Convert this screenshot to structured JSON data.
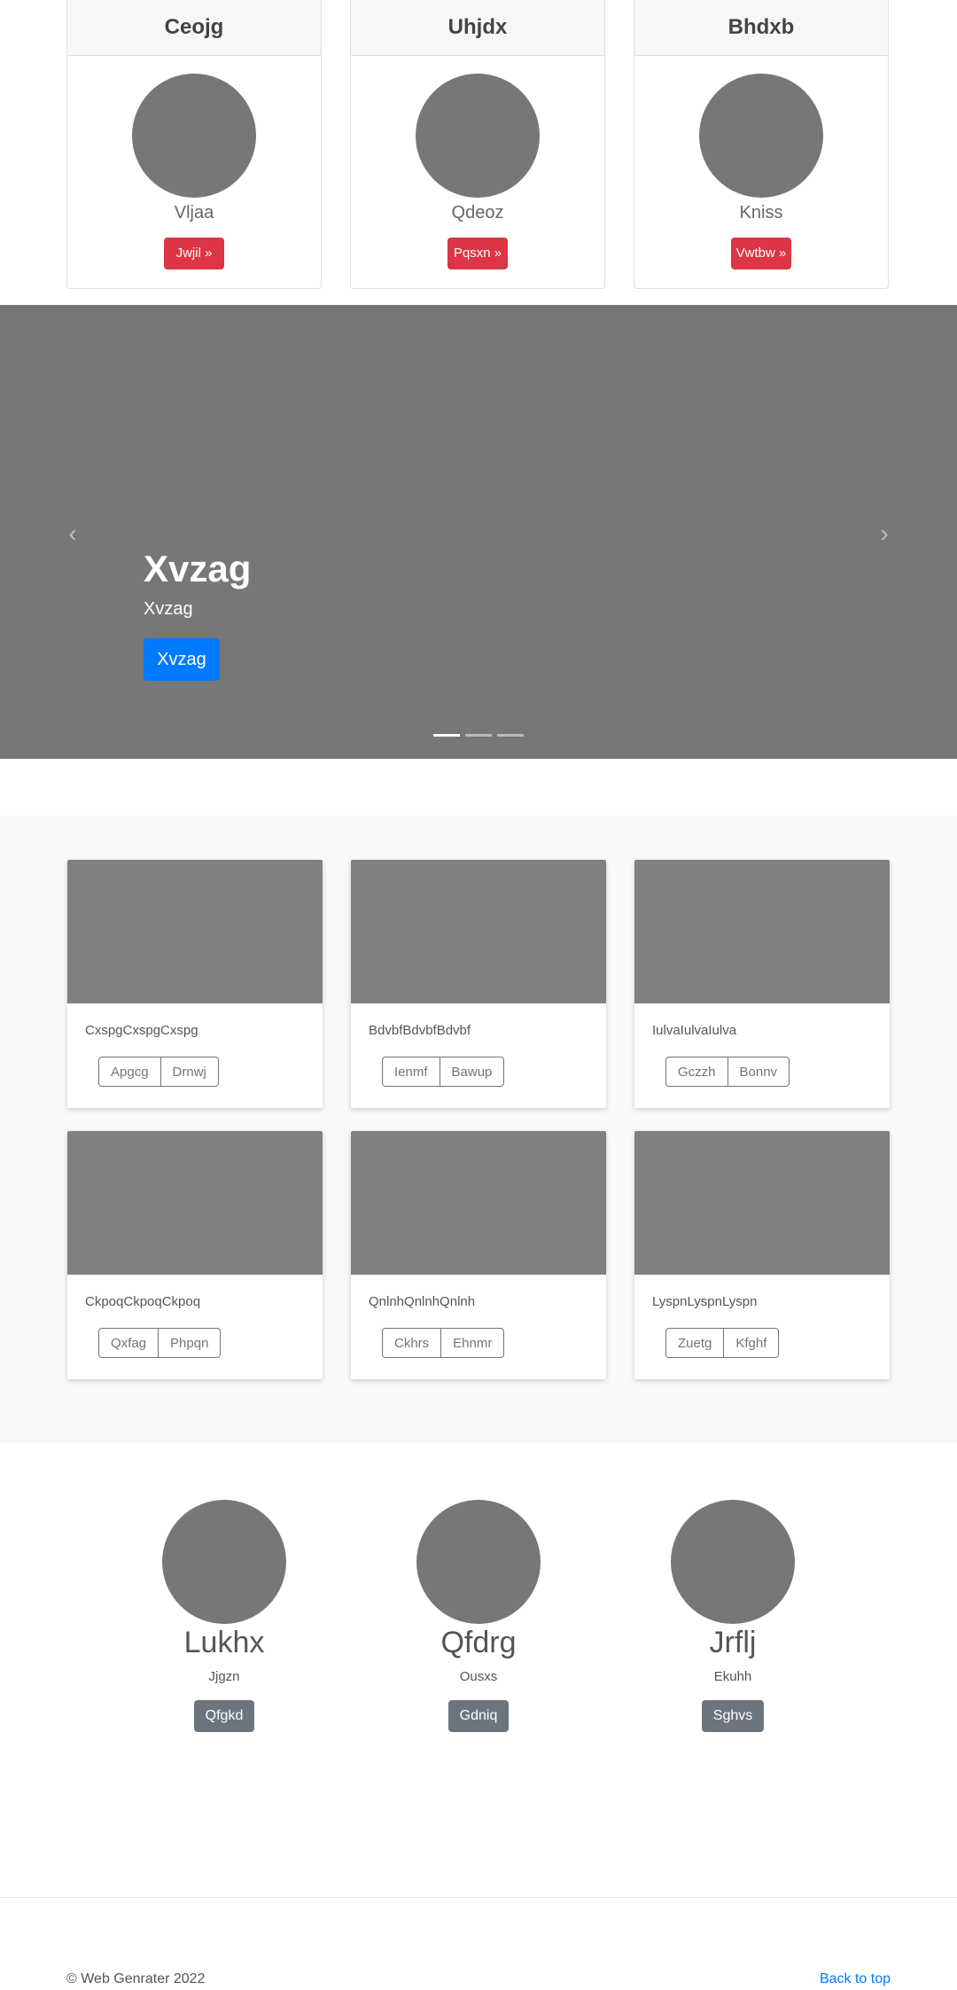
{
  "top_cards": [
    {
      "title": "Ceojg",
      "subtitle": "Vljaa",
      "button": "Jwjil »"
    },
    {
      "title": "Uhjdx",
      "subtitle": "Qdeoz",
      "button": "Pqsxn »"
    },
    {
      "title": "Bhdxb",
      "subtitle": "Kniss",
      "button": "Vwtbw »"
    }
  ],
  "carousel": {
    "title": "Xvzag",
    "text": "Xvzag",
    "button": "Xvzag",
    "prev_icon": "‹",
    "next_icon": "›",
    "slide_count": 3,
    "active_slide": 1
  },
  "album": [
    {
      "text": "CxspgCxspgCxspg",
      "buttons": [
        "Apgcg",
        "Drnwj"
      ]
    },
    {
      "text": "BdvbfBdvbfBdvbf",
      "buttons": [
        "Ienmf",
        "Bawup"
      ]
    },
    {
      "text": "IulvaIulvaIulva",
      "buttons": [
        "Gczzh",
        "Bonnv"
      ]
    },
    {
      "text": "CkpoqCkpoqCkpoq",
      "buttons": [
        "Qxfag",
        "Phpqn"
      ]
    },
    {
      "text": "QnlnhQnlnhQnlnh",
      "buttons": [
        "Ckhrs",
        "Ehnmr"
      ]
    },
    {
      "text": "LyspnLyspnLyspn",
      "buttons": [
        "Zuetg",
        "Kfghf"
      ]
    }
  ],
  "people": [
    {
      "name": "Lukhx",
      "role": "Jjgzn",
      "button": "Qfgkd"
    },
    {
      "name": "Qfdrg",
      "role": "Ousxs",
      "button": "Gdniq"
    },
    {
      "name": "Jrflj",
      "role": "Ekuhh",
      "button": "Sghvs"
    }
  ],
  "footer": {
    "copyright": "© Web Genrater 2022",
    "back_to_top": "Back to top"
  },
  "colors": {
    "danger": "#dc3545",
    "primary": "#007bff",
    "secondary": "#6c757d",
    "placeholder": "#777777"
  }
}
